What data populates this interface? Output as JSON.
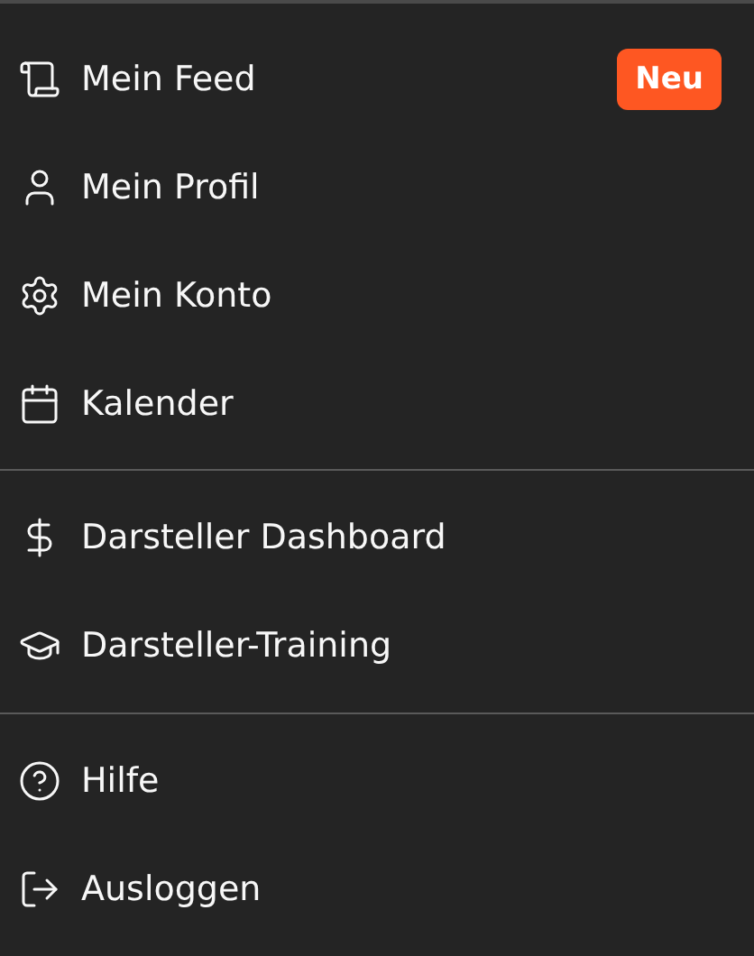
{
  "sections": [
    {
      "items": [
        {
          "label": "Mein Feed",
          "badge": "Neu"
        },
        {
          "label": "Mein Profil"
        },
        {
          "label": "Mein Konto"
        },
        {
          "label": "Kalender"
        }
      ]
    },
    {
      "items": [
        {
          "label": "Darsteller Dashboard"
        },
        {
          "label": "Darsteller-Training"
        }
      ]
    },
    {
      "items": [
        {
          "label": "Hilfe"
        },
        {
          "label": "Ausloggen"
        }
      ]
    }
  ]
}
